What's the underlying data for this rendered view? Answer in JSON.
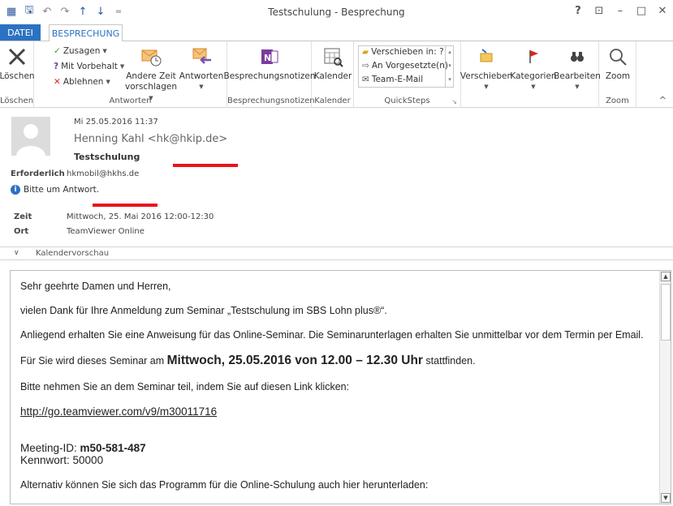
{
  "window": {
    "title": "Testschulung - Besprechung",
    "help": "?",
    "ribbon_toggle": "⊡",
    "minimize": "–",
    "maximize": "□",
    "close": "✕"
  },
  "qat": {
    "app_icon": "▦",
    "save": "🖫",
    "undo": "↶",
    "redo": "↷",
    "up": "↑",
    "down": "↓",
    "customize": "="
  },
  "tabs": {
    "file": "DATEI",
    "meeting": "BESPRECHUNG"
  },
  "ribbon": {
    "delete": {
      "button": "Löschen",
      "group": "Löschen"
    },
    "respond": {
      "accept": "Zusagen",
      "tentative": "Mit Vorbehalt",
      "decline": "Ablehnen",
      "propose_line1": "Andere Zeit",
      "propose_line2": "vorschlagen",
      "reply": "Antworten",
      "group": "Antworten"
    },
    "notes": {
      "button": "Besprechungsnotizen",
      "group": "Besprechungsnotizen"
    },
    "calendar": {
      "button": "Kalender",
      "group": "Kalender"
    },
    "quicksteps": {
      "items": [
        "Verschieben in: ?",
        "An Vorgesetzte(n)",
        "Team-E-Mail"
      ],
      "group": "QuickSteps",
      "launcher": "↘"
    },
    "move": "Verschieben",
    "categories": "Kategorien",
    "edit": "Bearbeiten",
    "zoom": {
      "button": "Zoom",
      "group": "Zoom"
    },
    "collapse": "^"
  },
  "header": {
    "sent": "Mi 25.05.2016 11:37",
    "sender": "Henning Kahl <hk@hkip.de>",
    "subject": "Testschulung",
    "required_label": "Erforderlich",
    "required_value": "hkmobil@hkhs.de",
    "info": "Bitte um Antwort.",
    "info_icon": "i",
    "time_label": "Zeit",
    "time_value": "Mittwoch, 25. Mai 2016 12:00-12:30",
    "place_label": "Ort",
    "place_value": "TeamViewer Online",
    "calendar_preview": "Kalendervorschau",
    "calendar_chevron": "∨"
  },
  "body": {
    "greeting": "Sehr geehrte Damen und Herren,",
    "thanks": "vielen Dank für Ihre Anmeldung zum Seminar „Testschulung im SBS Lohn plus®“.",
    "instructions": "Anliegend erhalten Sie eine Anweisung für das Online-Seminar. Die Seminarunterlagen erhalten Sie unmittelbar vor dem Termin per Email.",
    "seminar_prefix": "Für Sie wird dieses Seminar am ",
    "seminar_date": "Mittwoch, 25.05.2016 von 12.00 – 12.30 Uhr",
    "seminar_suffix": " stattfinden.",
    "join_text": "Bitte nehmen Sie an dem Seminar teil, indem Sie auf diesen Link klicken:",
    "link": "http://go.teamviewer.com/v9/m30011716",
    "meeting_id_label": "Meeting-ID: ",
    "meeting_id": "m50-581-487",
    "password": "Kennwort: 50000",
    "alternative": "Alternativ können Sie sich das Programm für die Online-Schulung auch hier herunterladen:"
  },
  "scroll": {
    "up": "▲",
    "down": "▼"
  },
  "colors": {
    "accent": "#2b72c2",
    "annotation_red": "#e8141a"
  }
}
